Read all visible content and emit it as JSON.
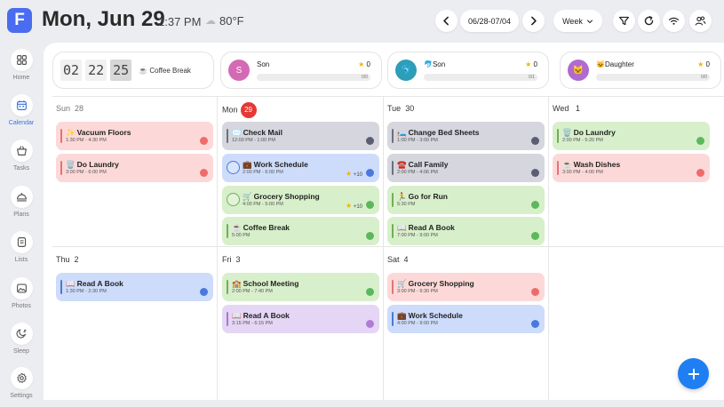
{
  "header": {
    "logo": "F",
    "date": "Mon, Jun 29",
    "time": "2:37 PM",
    "temperature": "80°F",
    "range": "06/28-07/04",
    "view": "Week"
  },
  "sidebar": {
    "items": [
      {
        "label": "Home",
        "icon": "grid-icon"
      },
      {
        "label": "Calendar",
        "icon": "calendar-icon",
        "active": true
      },
      {
        "label": "Tasks",
        "icon": "basket-icon"
      },
      {
        "label": "Plans",
        "icon": "dish-icon"
      },
      {
        "label": "Lists",
        "icon": "list-icon"
      },
      {
        "label": "Photos",
        "icon": "photo-icon"
      },
      {
        "label": "Sleep",
        "icon": "moon-icon"
      },
      {
        "label": "Settings",
        "icon": "gear-icon"
      }
    ]
  },
  "clock": {
    "d1": "02",
    "d2": "22",
    "d3": "25",
    "event": "☕ Coffee Break"
  },
  "members": [
    {
      "avatar_letter": "S",
      "avatar_color": "#d46ab3",
      "name": "Son",
      "stars": "0",
      "progress_text": "0/0",
      "progress": 0
    },
    {
      "avatar_letter": "🐬",
      "avatar_color": "#2e9db8",
      "name": "🐬Son",
      "stars": "0",
      "progress_text": "0/1",
      "progress": 0
    },
    {
      "avatar_letter": "🐱",
      "avatar_color": "#b06ad0",
      "name": "🐱Daughter",
      "stars": "0",
      "progress_text": "0/0",
      "progress": 0
    }
  ],
  "days": {
    "sun": {
      "name": "Sun",
      "num": "28"
    },
    "mon": {
      "name": "Mon",
      "num": "29"
    },
    "tue": {
      "name": "Tue",
      "num": "30"
    },
    "wed": {
      "name": "Wed",
      "num": "1"
    },
    "thu": {
      "name": "Thu",
      "num": "2"
    },
    "fri": {
      "name": "Fri",
      "num": "3"
    },
    "sat": {
      "name": "Sat",
      "num": "4"
    }
  },
  "events": {
    "sun": [
      {
        "icon": "✨",
        "title": "Vacuum Floors",
        "time": "1:30 PM - 4:30 PM"
      },
      {
        "icon": "🗑️",
        "title": "Do Laundry",
        "time": "3:00 PM - 6:00 PM"
      }
    ],
    "mon": [
      {
        "icon": "✉️",
        "title": "Check Mail",
        "time": "12:00 PM - 1:00 PM"
      },
      {
        "icon": "💼",
        "title": "Work Schedule",
        "time": "2:00 PM - 6:00 PM",
        "reward": "+10"
      },
      {
        "icon": "🛒",
        "title": "Grocery Shopping",
        "time": "4:00 PM - 5:00 PM",
        "reward": "+10"
      },
      {
        "icon": "☕",
        "title": "Coffee Break",
        "time": "5:00 PM"
      }
    ],
    "tue": [
      {
        "icon": "🛏️",
        "title": "Change Bed Sheets",
        "time": "1:00 PM - 3:00 PM"
      },
      {
        "icon": "☎️",
        "title": "Call Family",
        "time": "2:00 PM - 4:06 PM"
      },
      {
        "icon": "🏃",
        "title": "Go for Run",
        "time": "5:30 PM"
      },
      {
        "icon": "📖",
        "title": "Read A Book",
        "time": "7:00 PM - 9:00 PM"
      }
    ],
    "wed": [
      {
        "icon": "🗑️",
        "title": "Do Laundry",
        "time": "2:00 PM - 5:20 PM"
      },
      {
        "icon": "☕",
        "title": "Wash Dishes",
        "time": "3:00 PM - 4:00 PM"
      }
    ],
    "thu": [
      {
        "icon": "📖",
        "title": "Read A Book",
        "time": "1:30 PM - 2:30 PM"
      }
    ],
    "fri": [
      {
        "icon": "🏫",
        "title": "School Meeting",
        "time": "2:00 PM - 7:40 PM"
      },
      {
        "icon": "📖",
        "title": "Read A Book",
        "time": "3:15 PM - 6:15 PM"
      }
    ],
    "sat": [
      {
        "icon": "🛒",
        "title": "Grocery Shopping",
        "time": "3:00 PM - 9:30 PM"
      },
      {
        "icon": "💼",
        "title": "Work Schedule",
        "time": "4:00 PM - 9:00 PM"
      }
    ]
  },
  "colors": {
    "red": "#fcd9d8",
    "red_bar": "#e57373",
    "red_dot": "#ef6b6b",
    "gray": "#d5d6de",
    "gray_bar": "#6c6f80",
    "gray_dot": "#5b5e72",
    "blue": "#cddcfb",
    "blue_bar": "#4a78d6",
    "blue_dot": "#4a78e0",
    "green": "#d8efcb",
    "green_bar": "#6fb053",
    "green_dot": "#5cb85c",
    "purple": "#e4d6f4",
    "purple_bar": "#a678d4",
    "purple_dot": "#b07ad6",
    "accent": "#3b73e0",
    "today": "#e53935"
  }
}
